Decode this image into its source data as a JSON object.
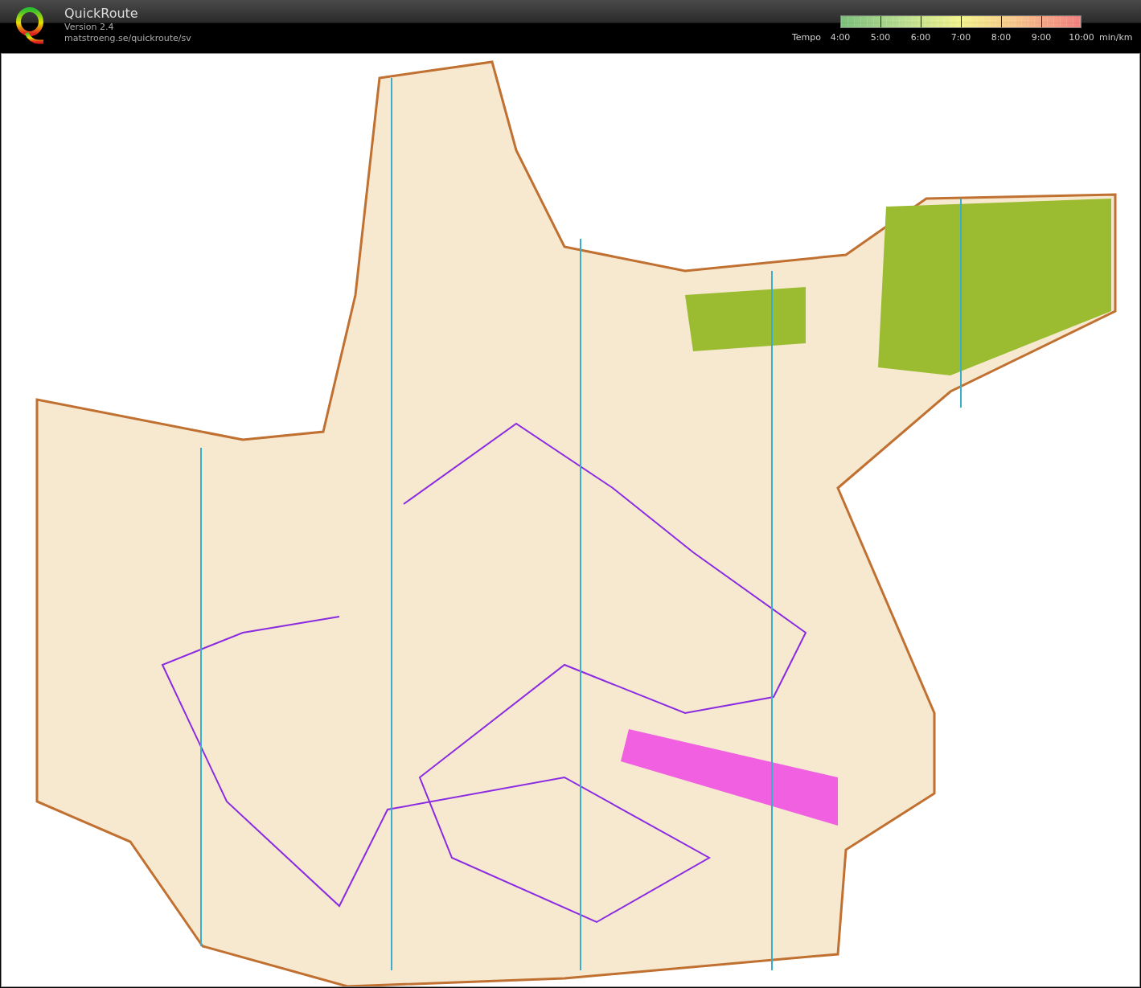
{
  "app": {
    "title": "QuickRoute",
    "version": "Version 2.4",
    "url": "matstroeng.se/quickroute/sv"
  },
  "pace_legend": {
    "label": "Tempo",
    "ticks": [
      "4:00",
      "5:00",
      "6:00",
      "7:00",
      "8:00",
      "9:00",
      "10:00"
    ],
    "unit": "min/km"
  }
}
